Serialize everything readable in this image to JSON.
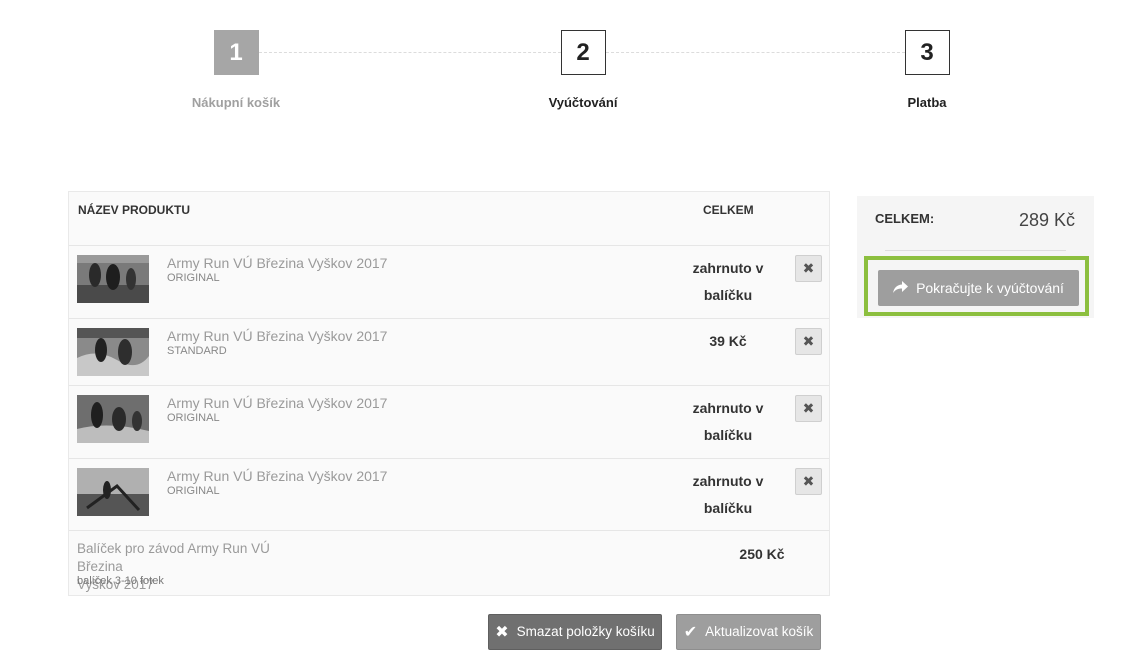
{
  "steps": [
    {
      "number": "1",
      "label": "Nákupní košík",
      "state": "done"
    },
    {
      "number": "2",
      "label": "Vyúčtování",
      "state": "current"
    },
    {
      "number": "3",
      "label": "Platba",
      "state": "upcoming"
    }
  ],
  "cart": {
    "headers": {
      "product": "NÁZEV PRODUKTU",
      "total": "CELKEM"
    },
    "items": [
      {
        "name": "Army Run VÚ Březina Vyškov 2017",
        "variant": "ORIGINAL",
        "price_line1": "zahrnuto v",
        "price_line2": "balíčku",
        "remove_icon": "close-icon"
      },
      {
        "name": "Army Run VÚ Březina Vyškov 2017",
        "variant": "STANDARD",
        "price_line1": "39 Kč",
        "price_line2": "",
        "remove_icon": "close-icon"
      },
      {
        "name": "Army Run VÚ Březina Vyškov 2017",
        "variant": "ORIGINAL",
        "price_line1": "zahrnuto v",
        "price_line2": "balíčku",
        "remove_icon": "close-icon"
      },
      {
        "name": "Army Run VÚ Březina Vyškov 2017",
        "variant": "ORIGINAL",
        "price_line1": "zahrnuto v",
        "price_line2": "balíčku",
        "remove_icon": "close-icon"
      }
    ],
    "bundle": {
      "name_line1": "Balíček pro závod Army Run VÚ Březina",
      "name_line2": "Vyškov 2017",
      "sub": "balíček 3-10 fotek",
      "price": "250 Kč"
    }
  },
  "summary": {
    "label": "CELKEM:",
    "value": "289 Kč",
    "continue_label": "Pokračujte k vyúčtování",
    "continue_icon": "share-arrow-icon",
    "highlight_color": "#8cbf3f"
  },
  "actions": {
    "clear_label": "Smazat položky košíku",
    "clear_icon": "close-icon",
    "update_label": "Aktualizovat košík",
    "update_icon": "checkmark-icon"
  }
}
